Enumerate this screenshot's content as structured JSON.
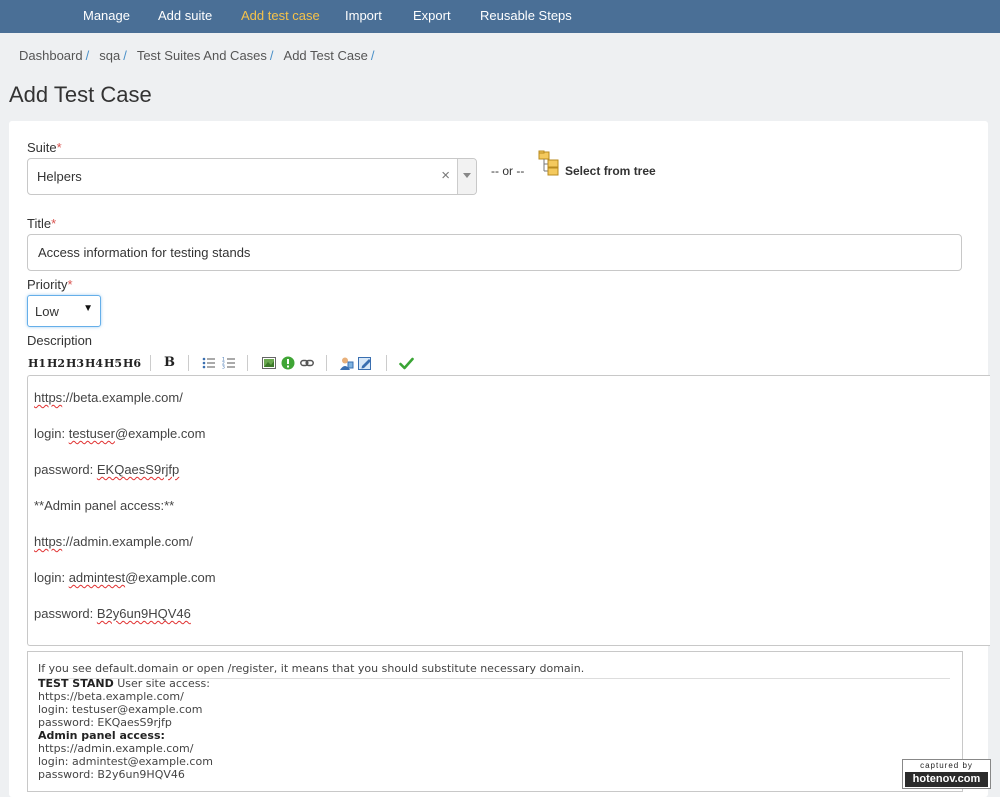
{
  "nav": {
    "items": [
      {
        "label": "Manage"
      },
      {
        "label": "Add suite"
      },
      {
        "label": "Add test case"
      },
      {
        "label": "Import"
      },
      {
        "label": "Export"
      },
      {
        "label": "Reusable Steps"
      }
    ],
    "active_color": "#f5c24a",
    "bg_color": "#4a6f96"
  },
  "breadcrumb": {
    "items": [
      "Dashboard",
      "sqa",
      "Test Suites And Cases",
      "Add Test Case"
    ],
    "separator": "/"
  },
  "page": {
    "title": "Add Test Case"
  },
  "form": {
    "suite": {
      "label": "Suite",
      "required_mark": "*",
      "value": "Helpers",
      "clear_glyph": "×"
    },
    "or_text": "-- or --",
    "tree_link": {
      "label": "Select from tree",
      "icon": "folder-tree-icon"
    },
    "title": {
      "label": "Title",
      "required_mark": "*",
      "value": "Access information for testing stands"
    },
    "priority": {
      "label": "Priority",
      "required_mark": "*",
      "value": "Low"
    },
    "description": {
      "label": "Description",
      "toolbar": {
        "headings": [
          "H1",
          "H2",
          "H3",
          "H4",
          "H5",
          "H6"
        ],
        "bold": "B",
        "icons": [
          "unordered-list-icon",
          "ordered-list-icon",
          "image-icon",
          "info-icon",
          "link-icon",
          "user-icon",
          "edit-icon",
          "check-icon"
        ]
      },
      "lines": {
        "l1a": "https",
        "l1b": "://beta.example.com/",
        "l2a": "login: ",
        "l2b": "testuser",
        "l2c": "@example.com",
        "l3a": "password: ",
        "l3b": "EKQaesS9rjfp",
        "l4": "**Admin panel access:**",
        "l5a": "https",
        "l5b": "://admin.example.com/",
        "l6a": "login: ",
        "l6b": "admintest",
        "l6c": "@example.com",
        "l7a": "password: ",
        "l7b": "B2y6un9HQV46"
      }
    },
    "preview": {
      "note": "If you see default.domain or open /register, it means that you should substitute necessary domain.",
      "test_stand_bold": "TEST STAND",
      "test_stand_rest": " User site access:",
      "user_url": "https://beta.example.com/",
      "user_login": "login: testuser@example.com",
      "user_password": "password: EKQaesS9rjfp",
      "admin_heading": "Admin panel access:",
      "admin_url": "https://admin.example.com/",
      "admin_login": "login: admintest@example.com",
      "admin_password": "password: B2y6un9HQV46"
    }
  },
  "watermark": {
    "top": "captured by",
    "bottom": "hotenov.com"
  }
}
